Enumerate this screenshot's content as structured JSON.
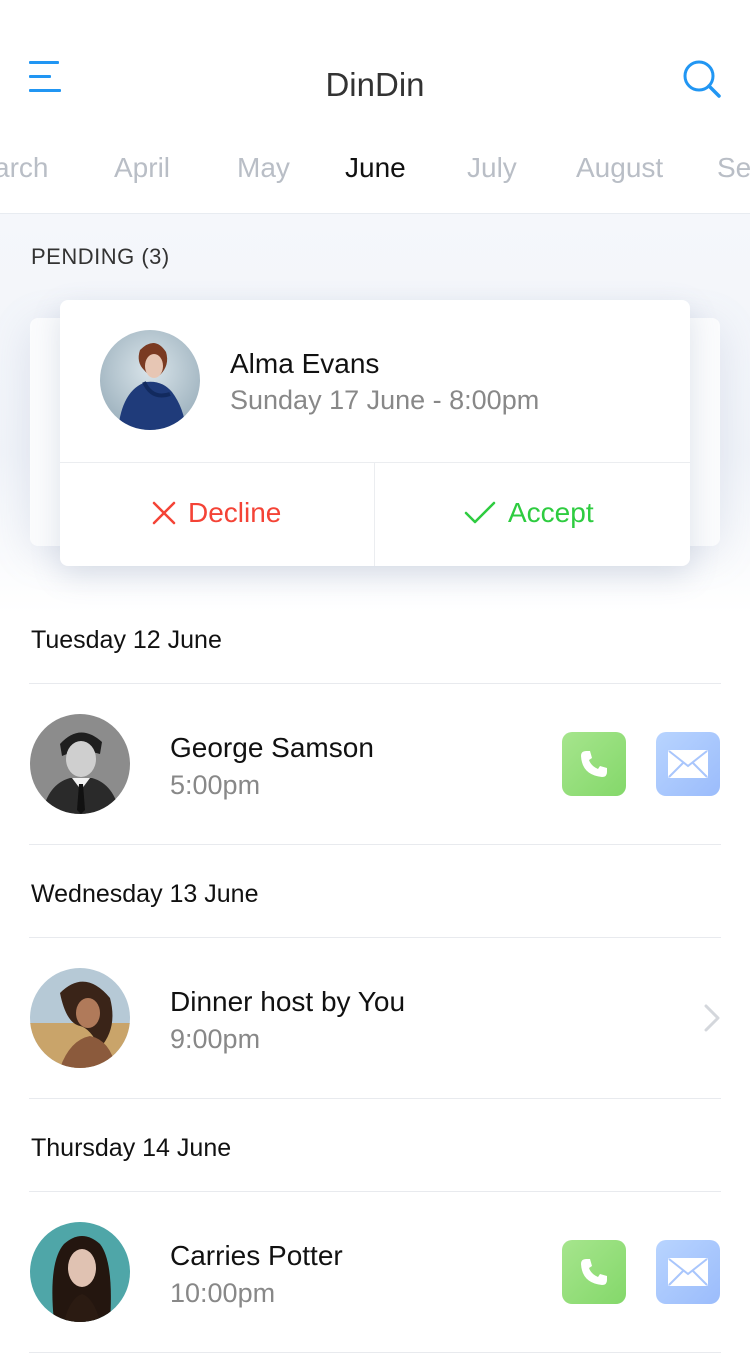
{
  "header": {
    "title": "DinDin",
    "menu_icon": "hamburger-menu-icon",
    "search_icon": "search-icon",
    "accent_color": "#2196f3"
  },
  "months": {
    "items": [
      "arch",
      "April",
      "May",
      "June",
      "July",
      "August",
      "Se"
    ],
    "selected": "June"
  },
  "pending": {
    "label": "PENDING (3)",
    "card": {
      "name": "Alma Evans",
      "datetime": "Sunday 17 June - 8:00pm",
      "decline_label": "Decline",
      "accept_label": "Accept",
      "decline_color": "#f44336",
      "accept_color": "#2ecc40"
    }
  },
  "schedule": [
    {
      "day": "Tuesday 12 June",
      "event": {
        "name": "George Samson",
        "time": "5:00pm",
        "actions": [
          "phone-icon",
          "mail-icon"
        ]
      }
    },
    {
      "day": "Wednesday 13 June",
      "event": {
        "name": "Dinner host by You",
        "time": "9:00pm",
        "actions": [
          "chevron-right-icon"
        ]
      }
    },
    {
      "day": "Thursday 14 June",
      "event": {
        "name": "Carries Potter",
        "time": "10:00pm",
        "actions": [
          "phone-icon",
          "mail-icon"
        ]
      }
    }
  ]
}
